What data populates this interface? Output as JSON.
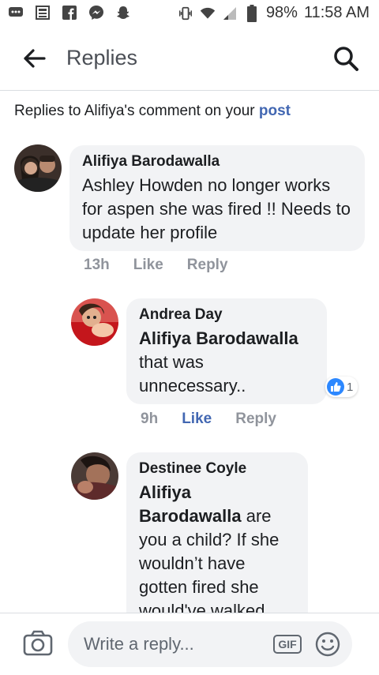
{
  "statusbar": {
    "battery": "98%",
    "time": "11:58 AM"
  },
  "appbar": {
    "title": "Replies"
  },
  "context": {
    "prefix": "Replies to Alifiya's comment on your ",
    "link": "post"
  },
  "comments": [
    {
      "author": "Alifiya Barodawalla",
      "mention": "",
      "text": "Ashley Howden no longer works for aspen she was fired !! Needs to update her profile",
      "time": "13h",
      "like": "Like",
      "reply": "Reply",
      "reactions": ""
    },
    {
      "author": "Andrea Day",
      "mention": "Alifiya Barodawalla",
      "text": "that was unnecessary..",
      "time": "9h",
      "like": "Like",
      "reply": "Reply",
      "reactions": "1"
    },
    {
      "author": "Destinee Coyle",
      "mention": "Alifiya Barodawalla",
      "text": " are you a child? If she wouldn’t have gotten fired she would've walked",
      "time": "",
      "like": "",
      "reply": "",
      "reactions": ""
    }
  ],
  "composer": {
    "placeholder": "Write a reply...",
    "gif": "GIF"
  },
  "colors": {
    "accent": "#4267b2",
    "bubble": "#f2f3f5",
    "meta": "#90949c"
  }
}
